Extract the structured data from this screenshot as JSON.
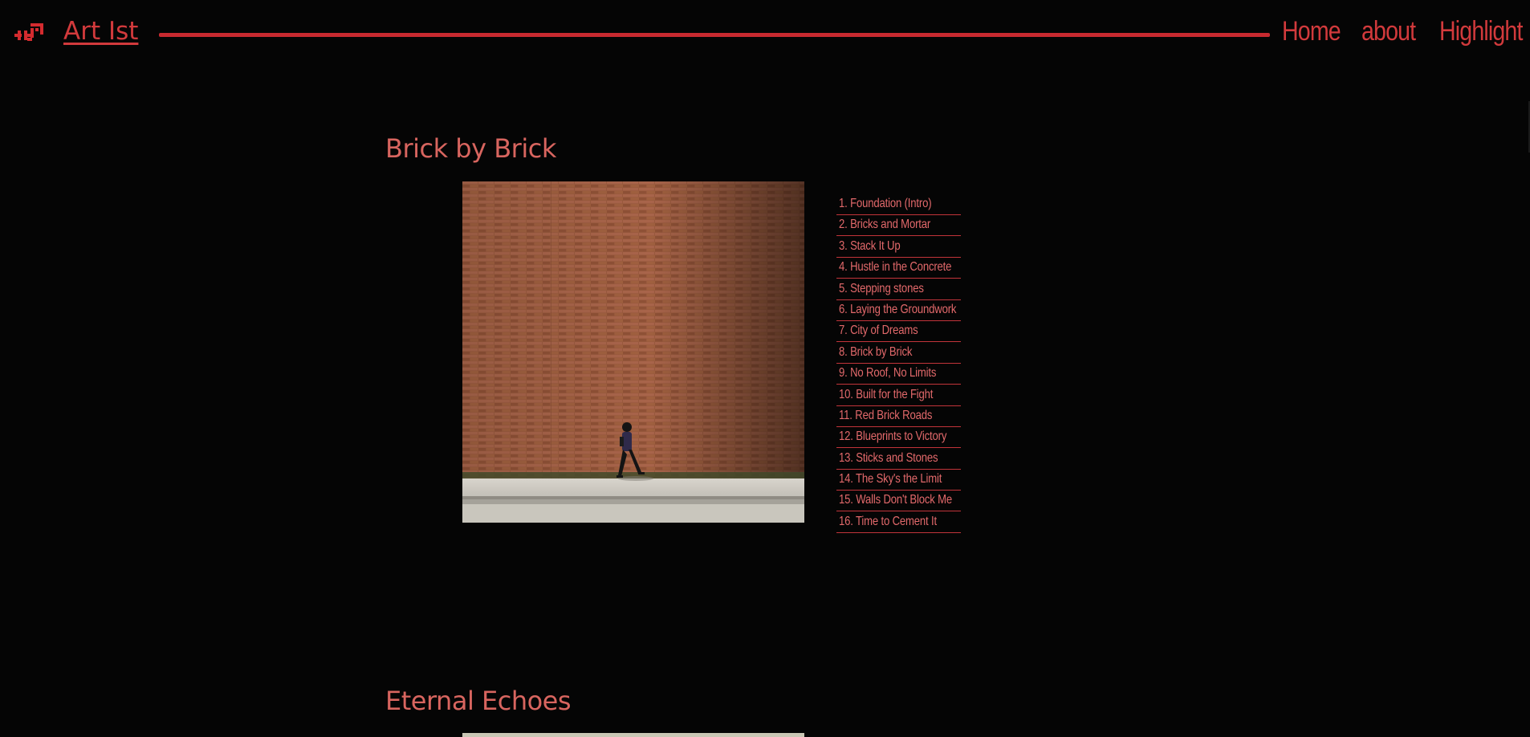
{
  "header": {
    "brand": "Art Ist",
    "nav": [
      "Home",
      "about",
      "Highlight"
    ]
  },
  "albums": [
    {
      "title": "Brick by Brick",
      "tracks": [
        "1. Foundation (Intro)",
        "2. Bricks and Mortar",
        "3. Stack It Up",
        "4. Hustle in the Concrete",
        "5. Stepping stones",
        "6. Laying the Groundwork",
        "7. City of Dreams",
        "8. Brick by Brick",
        "9. No Roof, No Limits",
        "10. Built for the Fight",
        "11. Red Brick Roads",
        "12. Blueprints to Victory",
        "13. Sticks and Stones",
        "14. The Sky's the Limit",
        "15. Walls Don't Block Me",
        "16. Time to Cement It"
      ]
    },
    {
      "title": "Eternal Echoes"
    }
  ],
  "colors": {
    "accent": "#d23a3c",
    "title": "#d8655f",
    "background": "#050505"
  }
}
